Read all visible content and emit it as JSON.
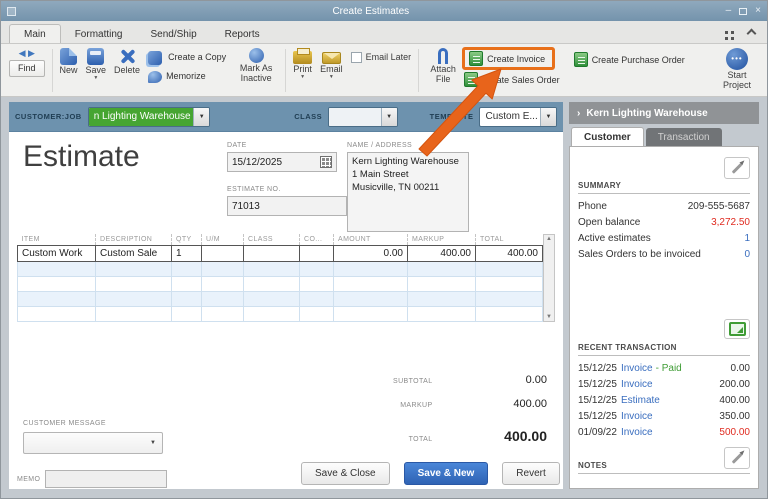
{
  "colors": {
    "titlebar_blue": "#7e9cb4",
    "accent_orange": "#e8701a",
    "link_blue": "#3a6ebf",
    "negative_red": "#e02b20",
    "positive_green": "#3f9c35",
    "primary_button_blue": "#3a6fc0",
    "customer_highlight_green": "#46a532"
  },
  "window": {
    "title": "Create Estimates"
  },
  "ribbon": {
    "tabs": [
      {
        "label": "Main"
      },
      {
        "label": "Formatting"
      },
      {
        "label": "Send/Ship"
      },
      {
        "label": "Reports"
      }
    ]
  },
  "toolbar": {
    "find": "Find",
    "new": "New",
    "save": "Save",
    "delete": "Delete",
    "create_a_copy": "Create a Copy",
    "memorize": "Memorize",
    "mark_as_inactive": "Mark As Inactive",
    "print": "Print",
    "email": "Email",
    "email_later": "Email Later",
    "attach_file": "Attach File",
    "create_invoice": "Create Invoice",
    "create_sales_order": "Create Sales Order",
    "create_purchase_order": "Create Purchase Order",
    "start_project": "Start Project"
  },
  "form_header": {
    "customer_job_label": "CUSTOMER:JOB",
    "customer_job_value": "n Lighting Warehouse",
    "class_label": "CLASS",
    "template_label": "TEMPLATE",
    "template_value": "Custom E..."
  },
  "form": {
    "title": "Estimate",
    "date": {
      "label": "DATE",
      "value": "15/12/2025"
    },
    "estimate_no": {
      "label": "ESTIMATE NO.",
      "value": "71013"
    },
    "name_address": {
      "label": "NAME / ADDRESS",
      "lines": [
        "Kern Lighting Warehouse",
        "1 Main Street",
        "Musicville, TN 00211"
      ]
    },
    "table": {
      "headers": [
        "ITEM",
        "DESCRIPTION",
        "QTY",
        "U/M",
        "CLASS",
        "CO...",
        "AMOUNT",
        "MARKUP",
        "TOTAL"
      ],
      "row1": [
        "Custom Work",
        "Custom Sale",
        "1",
        "",
        "",
        "",
        "0.00",
        "400.00",
        "400.00"
      ]
    },
    "totals": {
      "subtotal_label": "SUBTOTAL",
      "subtotal": "0.00",
      "markup_label": "MARKUP",
      "markup": "400.00",
      "total_label": "TOTAL",
      "total": "400.00"
    },
    "customer_message_label": "CUSTOMER MESSAGE",
    "memo_label": "MEMO",
    "buttons": {
      "save_close": "Save & Close",
      "save_new": "Save & New",
      "revert": "Revert"
    }
  },
  "panel": {
    "title": "Kern Lighting Warehouse",
    "tabs": {
      "customer": "Customer",
      "transaction": "Transaction"
    },
    "summary": {
      "heading": "SUMMARY",
      "rows": [
        {
          "label": "Phone",
          "value": "209-555-5687"
        },
        {
          "label": "Open balance",
          "value": "3,272.50"
        },
        {
          "label": "Active estimates",
          "value": "1"
        },
        {
          "label": "Sales Orders to be invoiced",
          "value": "0"
        }
      ]
    },
    "recent": {
      "heading": "RECENT TRANSACTION",
      "rows": [
        {
          "date": "15/12/25",
          "link": "Invoice",
          "suffix": "- Paid",
          "amount": "0.00"
        },
        {
          "date": "15/12/25",
          "link": "Invoice",
          "suffix": "",
          "amount": "200.00"
        },
        {
          "date": "15/12/25",
          "link": "Estimate",
          "suffix": "",
          "amount": "400.00"
        },
        {
          "date": "15/12/25",
          "link": "Invoice",
          "suffix": "",
          "amount": "350.00"
        },
        {
          "date": "01/09/22",
          "link": "Invoice",
          "suffix": "",
          "amount": "500.00"
        }
      ]
    },
    "notes": {
      "heading": "NOTES"
    }
  }
}
